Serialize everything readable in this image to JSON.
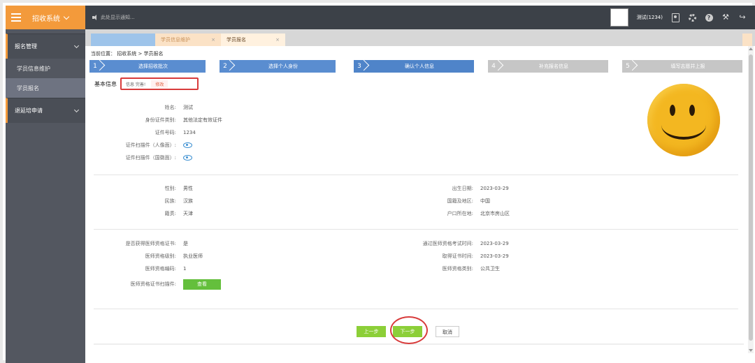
{
  "header": {
    "app_title": "招收系统",
    "notice": "此处显示通知...",
    "username": "测试(1234)"
  },
  "sidebar": {
    "groups": [
      {
        "label": "报名管理",
        "items": [
          {
            "label": "学员信息维护"
          },
          {
            "label": "学员报名",
            "active": true
          }
        ]
      },
      {
        "label": "退延培申请",
        "items": []
      }
    ]
  },
  "tabs": [
    {
      "label": ""
    },
    {
      "label": "学员信息维护",
      "close": "×"
    },
    {
      "label": "学员报名",
      "close": "×"
    }
  ],
  "breadcrumb": "当前位置： 招收系统 > 学员报名",
  "steps": [
    {
      "num": "1",
      "label": "选择招收批次",
      "state": "done"
    },
    {
      "num": "2",
      "label": "选择个人身份",
      "state": "done"
    },
    {
      "num": "3",
      "label": "确认个人信息",
      "state": "current"
    },
    {
      "num": "4",
      "label": "补充报名信息",
      "state": "todo"
    },
    {
      "num": "5",
      "label": "填写志愿并上报",
      "state": "todo"
    }
  ],
  "basic_info": {
    "label": "基本信息",
    "status_text": "信息 完善!",
    "modify": "修改"
  },
  "identity": {
    "name_k": "姓名:",
    "name_v": "测试",
    "idtype_k": "身份证件类别:",
    "idtype_v": "其他法定有效证件",
    "idno_k": "证件号码:",
    "idno_v": "1234",
    "scan_front_k": "证件扫描件（人像面）:",
    "scan_back_k": "证件扫描件（国徽面）:"
  },
  "personal": {
    "gender_k": "性别:",
    "gender_v": "男性",
    "birth_k": "出生日期:",
    "birth_v": "2023-03-29",
    "ethnic_k": "民族:",
    "ethnic_v": "汉族",
    "country_k": "国籍及地区:",
    "country_v": "中国",
    "native_k": "籍贯:",
    "native_v": "天津",
    "hukou_k": "户口所在地:",
    "hukou_v": "北京市房山区"
  },
  "qualification": {
    "has_cert_k": "是否获得医师资格证书:",
    "has_cert_v": "是",
    "exam_time_k": "通过医师资格考试时间:",
    "exam_time_v": "2023-03-29",
    "level_k": "医师资格级别:",
    "level_v": "执业医师",
    "cert_time_k": "取得证书时间:",
    "cert_time_v": "2023-03-29",
    "code_k": "医师资格编码:",
    "code_v": "1",
    "type_k": "医师资格类别:",
    "type_v": "公共卫生",
    "scan_k": "医师资格证书扫描件:",
    "view_btn": "查看"
  },
  "actions": {
    "prev": "上一步",
    "next": "下一步",
    "cancel": "取消"
  },
  "colors": {
    "topbar": "#3c4148",
    "accent": "#f39a3b",
    "step_active": "#5a8dd0",
    "step_todo": "#c6c6c6",
    "green": "#8ccf38",
    "highlight": "#d83b3b"
  }
}
